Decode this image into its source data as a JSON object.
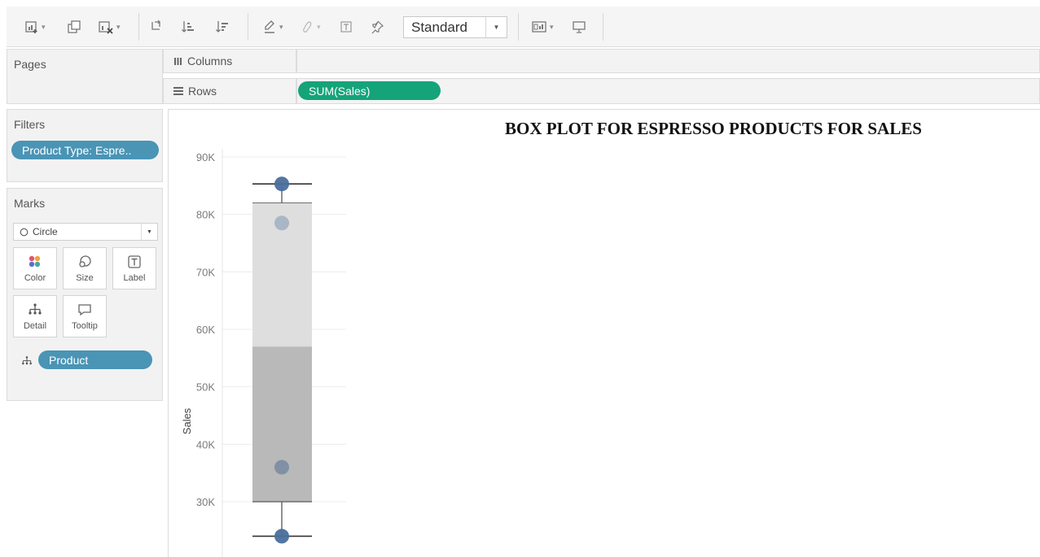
{
  "toolbar": {
    "fit_select_value": "Standard",
    "buttons": [
      "new-worksheet-icon",
      "duplicate-sheet-icon",
      "clear-sheet-icon",
      "swap-axes-icon",
      "sort-ascending-icon",
      "sort-descending-icon",
      "highlight-icon",
      "group-icon",
      "labels-icon",
      "pin-icon",
      "show-cards-icon",
      "presentation-icon"
    ]
  },
  "panels": {
    "pages_title": "Pages",
    "filters_title": "Filters",
    "filter_pill": "Product Type: Espre..",
    "marks_title": "Marks",
    "mark_type": "Circle",
    "mark_buttons": {
      "color": "Color",
      "size": "Size",
      "label": "Label",
      "detail": "Detail",
      "tooltip": "Tooltip"
    },
    "detail_pill": "Product"
  },
  "shelves": {
    "columns_label": "Columns",
    "rows_label": "Rows",
    "rows_pill": "SUM(Sales)"
  },
  "colors": {
    "toolbar_bg": "#f5f5f5",
    "pill_blue": "#4a94b5",
    "pill_green": "#15a37a",
    "point_dark": "#4a6f9c",
    "point_light": "#a5b3c4",
    "box_lower": "#b9b9b9",
    "box_upper": "#dedede"
  },
  "chart_data": {
    "type": "box",
    "title": "BOX PLOT FOR ESPRESSO PRODUCTS FOR SALES",
    "ylabel": "Sales",
    "ylim": [
      20000,
      92000
    ],
    "yticks": [
      30000,
      40000,
      50000,
      60000,
      70000,
      80000,
      90000
    ],
    "ytick_labels": [
      "30K",
      "40K",
      "50K",
      "60K",
      "70K",
      "80K",
      "90K"
    ],
    "box": {
      "whisker_low": 24000,
      "q1": 30000,
      "median": 57000,
      "q3": 82000,
      "whisker_high": 85300
    },
    "points": [
      {
        "value": 85300,
        "shade": "dark"
      },
      {
        "value": 78500,
        "shade": "light"
      },
      {
        "value": 36000,
        "shade": "mid"
      },
      {
        "value": 24000,
        "shade": "dark"
      }
    ]
  }
}
